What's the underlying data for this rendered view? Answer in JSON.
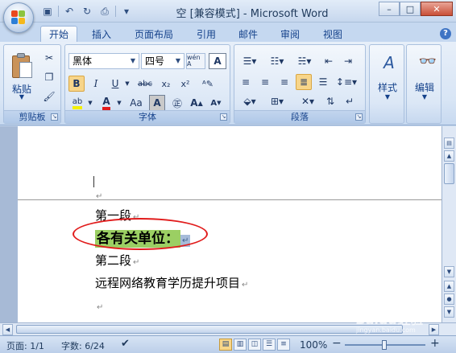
{
  "window": {
    "title": "空 [兼容模式] - Microsoft Word",
    "controls": {
      "minimize": "–",
      "maximize": "□",
      "close": "✕"
    }
  },
  "quick_access": {
    "icons": [
      "save-icon",
      "undo-icon",
      "redo-icon",
      "print-icon",
      "customize-icon"
    ]
  },
  "tabs": [
    {
      "label": "开始",
      "active": true
    },
    {
      "label": "插入",
      "active": false
    },
    {
      "label": "页面布局",
      "active": false
    },
    {
      "label": "引用",
      "active": false
    },
    {
      "label": "邮件",
      "active": false
    },
    {
      "label": "审阅",
      "active": false
    },
    {
      "label": "视图",
      "active": false
    }
  ],
  "help": "?",
  "ribbon": {
    "clipboard": {
      "label": "剪贴板",
      "paste_label": "粘贴"
    },
    "font": {
      "label": "字体",
      "font_name": "黑体",
      "font_size": "四号",
      "phonetic": "wén A",
      "bold": "B",
      "italic": "I",
      "underline": "U",
      "strike": "abc",
      "subscript": "x₂",
      "superscript": "x²",
      "font_color": "A",
      "change_case": "Aa",
      "char_shading": "A",
      "grow": "A",
      "shrink": "A"
    },
    "paragraph": {
      "label": "段落"
    },
    "styles": {
      "label": "样式"
    },
    "editing": {
      "label": "编辑"
    }
  },
  "document": {
    "paragraphs": [
      {
        "text": "第一段",
        "mark": "↵"
      },
      {
        "text": "各有关单位：",
        "mark": "↵",
        "highlighted": true
      },
      {
        "text": "第二段",
        "mark": "↵"
      },
      {
        "text": "远程网络教育学历提升项目",
        "mark": "↵"
      },
      {
        "text": "",
        "mark": "↵"
      }
    ],
    "header_mark": "↵"
  },
  "statusbar": {
    "page": "页面: 1/1",
    "words": "字数: 6/24",
    "zoom": "100%",
    "zoom_out": "−",
    "zoom_in": "+"
  },
  "watermark": {
    "brand": "Baidu经验",
    "url": "jingyan.baidu.com"
  },
  "colors": {
    "highlight": "#9bcf63",
    "annotation": "#e11b1b",
    "accent": "#15428b"
  }
}
